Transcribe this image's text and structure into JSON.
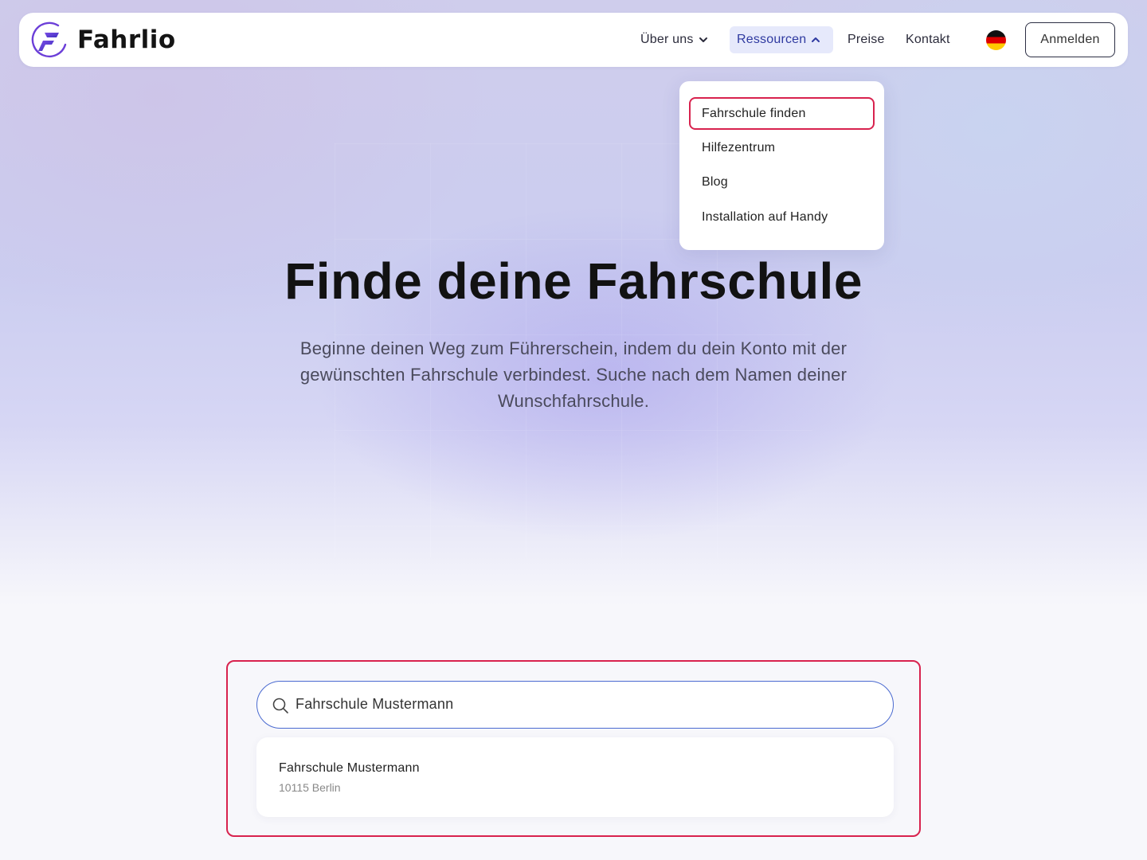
{
  "brand": {
    "name": "Fahrlio",
    "accent": "#6c3fd8"
  },
  "nav": {
    "items": [
      {
        "label": "Über uns",
        "has_dropdown": true,
        "open": false
      },
      {
        "label": "Ressourcen",
        "has_dropdown": true,
        "open": true
      },
      {
        "label": "Preise"
      },
      {
        "label": "Kontakt"
      }
    ],
    "language_flag": "germany-flag-icon",
    "login_label": "Anmelden"
  },
  "dropdown": {
    "items": [
      {
        "label": "Fahrschule finden",
        "highlighted": true
      },
      {
        "label": "Hilfezentrum"
      },
      {
        "label": "Blog"
      },
      {
        "label": "Installation auf Handy"
      }
    ]
  },
  "hero": {
    "title": "Finde deine Fahrschule",
    "subtitle": "Beginne deinen Weg zum Führerschein, indem du dein Konto mit der gewünschten Fahrschule verbindest. Suche nach dem Namen deiner Wunschfahrschule."
  },
  "search": {
    "value": "Fahrschule Mustermann",
    "icon": "search-icon",
    "results": [
      {
        "name": "Fahrschule Mustermann",
        "address": "10115 Berlin"
      }
    ]
  },
  "colors": {
    "highlight": "#d8224e",
    "search_border": "#4a6ad0",
    "nav_active_bg": "#e6e9fb"
  }
}
